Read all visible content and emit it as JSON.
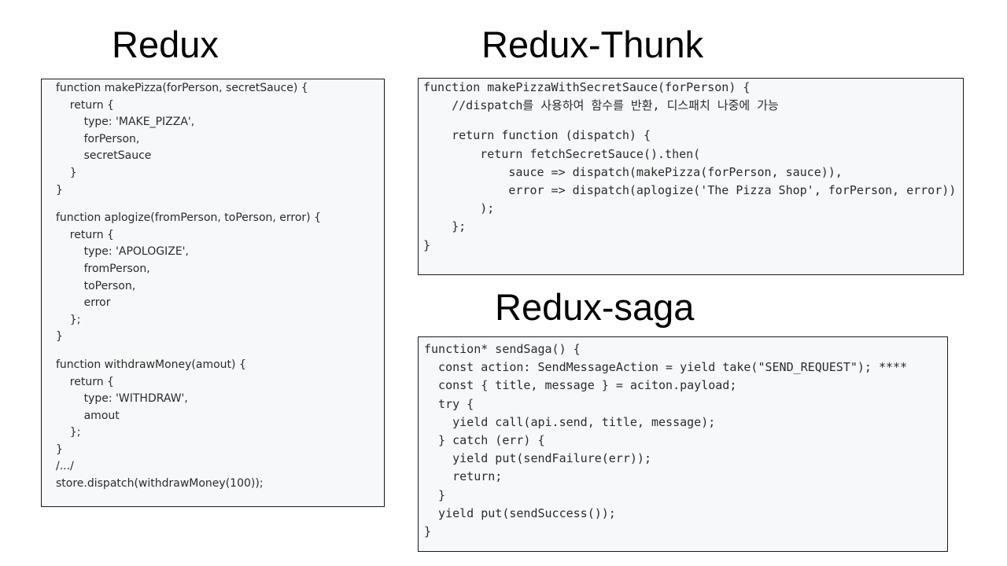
{
  "slide": {
    "redux_title": "Redux",
    "thunk_title": "Redux-Thunk",
    "saga_title": "Redux-saga"
  },
  "redux_code": [
    "function makePizza(forPerson, secretSauce) {",
    "    return {",
    "        type: 'MAKE_PIZZA',",
    "        forPerson,",
    "        secretSauce",
    "    }",
    "}",
    "",
    "function aplogize(fromPerson, toPerson, error) {",
    "    return {",
    "        type: 'APOLOGIZE',",
    "        fromPerson,",
    "        toPerson,",
    "        error",
    "    };",
    "}",
    "",
    "function withdrawMoney(amout) {",
    "    return {",
    "        type: 'WITHDRAW',",
    "        amout",
    "    };",
    "}",
    "/.../",
    "store.dispatch(withdrawMoney(100));"
  ],
  "thunk_code": [
    "function makePizzaWithSecretSauce(forPerson) {",
    "    //dispatch를 사용하여 함수를 반환, 디스패치 나중에 가능",
    "",
    "    return function (dispatch) {",
    "        return fetchSecretSauce().then(",
    "            sauce => dispatch(makePizza(forPerson, sauce)),",
    "            error => dispatch(aplogize('The Pizza Shop', forPerson, error))",
    "        );",
    "    };",
    "}"
  ],
  "saga_code": [
    "function* sendSaga() {",
    "  const action: SendMessageAction = yield take(\"SEND_REQUEST\"); ****",
    "  const { title, message } = aciton.payload;",
    "  try {",
    "    yield call(api.send, title, message);",
    "  } catch (err) {",
    "    yield put(sendFailure(err));",
    "    return;",
    "  }",
    "  yield put(sendSuccess());",
    "}"
  ]
}
